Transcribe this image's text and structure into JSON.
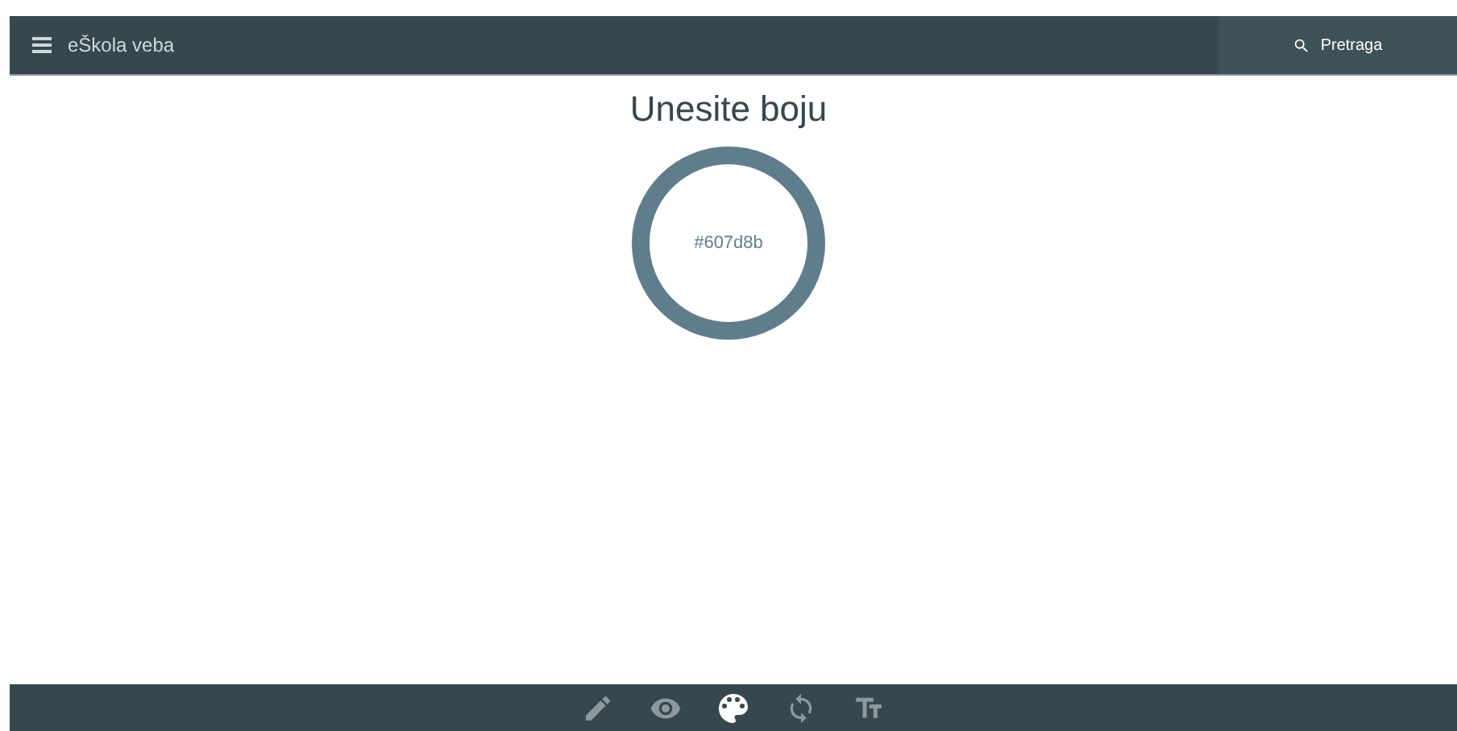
{
  "header": {
    "title": "eŠkola veba",
    "search": {
      "label": "Pretraga"
    }
  },
  "main": {
    "heading": "Unesite boju",
    "swatch": {
      "value": "#607d8b",
      "color": "#607d8b"
    }
  },
  "toolbar": [
    {
      "kind": "pencil",
      "selected": false
    },
    {
      "kind": "eye",
      "selected": false
    },
    {
      "kind": "palette",
      "selected": true
    },
    {
      "kind": "sync",
      "selected": false
    },
    {
      "kind": "text-size",
      "selected": false
    }
  ]
}
